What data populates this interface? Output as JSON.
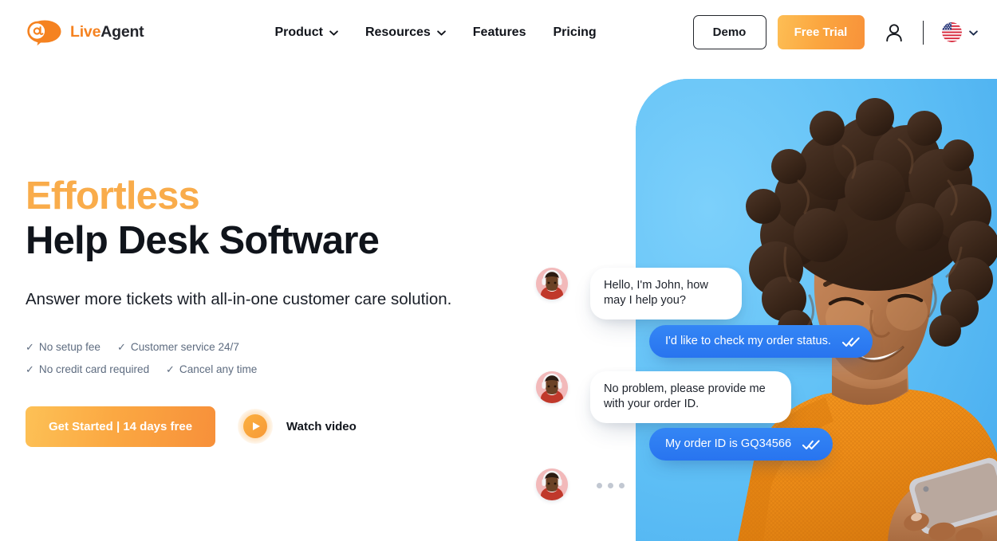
{
  "brand": {
    "logo_icon": "speech-bubble-at-icon",
    "name_first": "Live",
    "name_second": "Agent",
    "accent_orange": "#F58220",
    "dark": "#23252B"
  },
  "header": {
    "nav": [
      {
        "label": "Product",
        "has_dropdown": true,
        "icon": "chevron-down-icon"
      },
      {
        "label": "Resources",
        "has_dropdown": true,
        "icon": "chevron-down-icon"
      },
      {
        "label": "Features",
        "has_dropdown": false
      },
      {
        "label": "Pricing",
        "has_dropdown": false
      }
    ],
    "demo_label": "Demo",
    "trial_label": "Free Trial",
    "account_icon": "user-account-icon",
    "language": {
      "flag_icon": "us-flag-icon",
      "chevron_icon": "chevron-down-icon"
    }
  },
  "hero": {
    "headline_accent": "Effortless",
    "headline_main": "Help Desk Software",
    "subheadline": "Answer more tickets with all-in-one customer care solution.",
    "features": [
      {
        "check": "✓",
        "label": "No setup fee"
      },
      {
        "check": "✓",
        "label": "Customer service 24/7"
      },
      {
        "check": "✓",
        "label": "No credit card required"
      },
      {
        "check": "✓",
        "label": "Cancel any time"
      }
    ],
    "primary_cta": "Get Started | 14 days free",
    "video_label": "Watch video",
    "play_icon": "play-icon",
    "panel_color": "#62C4F8"
  },
  "chat": {
    "messages": [
      {
        "from": "agent",
        "text": "Hello, I'm John, how may I help you?",
        "avatar": "agent-avatar-headset"
      },
      {
        "from": "user",
        "text": "I'd like to check my order status.",
        "status_icon": "double-check-icon"
      },
      {
        "from": "agent",
        "text": "No problem, please provide me with your order ID.",
        "avatar": "agent-avatar-headset"
      },
      {
        "from": "user",
        "text": "My order ID is GQ34566",
        "status_icon": "double-check-icon"
      },
      {
        "from": "agent",
        "text": "",
        "typing": true,
        "avatar": "agent-avatar-headset"
      }
    ],
    "agent_bubble_color": "#FFFFFF",
    "user_bubble_color": "#2E7BF0"
  }
}
